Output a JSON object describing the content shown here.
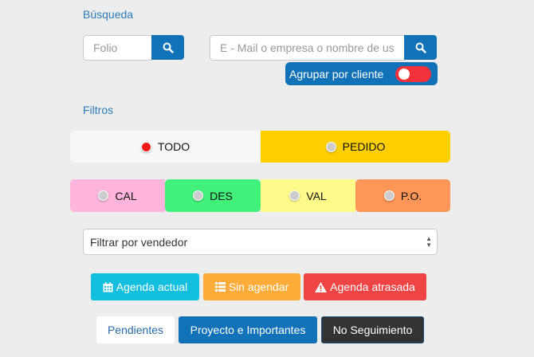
{
  "search": {
    "label": "Búsqueda",
    "folio_placeholder": "Folio",
    "email_placeholder": "E - Mail o empresa o nombre de us",
    "group_label": "Agrupar por cliente",
    "group_on": false
  },
  "filters": {
    "label": "Filtros",
    "primary": [
      {
        "label": "TODO",
        "color": "#f7f7f7",
        "selected": true
      },
      {
        "label": "PEDIDO",
        "color": "#ffcf00",
        "selected": false
      }
    ],
    "secondary": [
      {
        "label": "CAL",
        "color": "#fdb5dc"
      },
      {
        "label": "DES",
        "color": "#42f17a"
      },
      {
        "label": "VAL",
        "color": "#fefb8a"
      },
      {
        "label": "P.O.",
        "color": "#fe9658"
      }
    ],
    "vendor_select": "Filtrar por vendedor"
  },
  "agenda": [
    {
      "label": "Agenda actual",
      "icon": "calendar-icon",
      "color": "#12bfdf"
    },
    {
      "label": "Sin agendar",
      "icon": "list-icon",
      "color": "#fdac3a"
    },
    {
      "label": "Agenda atrasada",
      "icon": "warning-icon",
      "color": "#ef4444"
    }
  ],
  "status": [
    {
      "label": "Pendientes"
    },
    {
      "label": "Proyecto e Importantes"
    },
    {
      "label": "No Seguimiento"
    }
  ]
}
